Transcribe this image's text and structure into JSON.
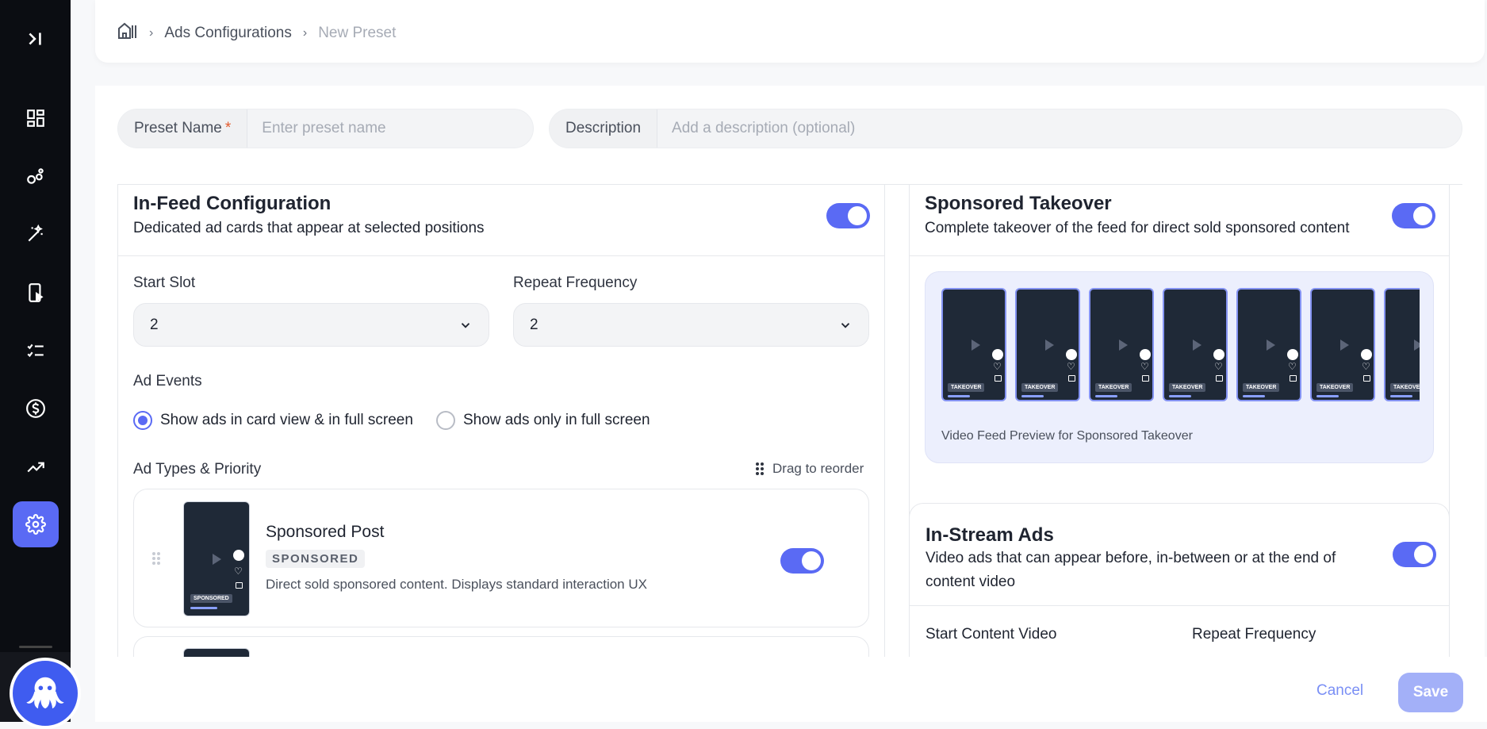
{
  "breadcrumb": {
    "items": [
      "Ads Configurations",
      "New Preset"
    ]
  },
  "form": {
    "preset_name_label": "Preset Name",
    "preset_name_required": "*",
    "preset_name_placeholder": "Enter preset name",
    "description_label": "Description",
    "description_placeholder": "Add a description (optional)"
  },
  "in_feed": {
    "title": "In-Feed Configuration",
    "subtitle": "Dedicated ad cards that appear at selected positions",
    "enabled": true,
    "start_slot_label": "Start Slot",
    "start_slot_value": "2",
    "repeat_frequency_label": "Repeat Frequency",
    "repeat_frequency_value": "2",
    "ad_events_label": "Ad Events",
    "ad_events_options": [
      "Show ads in card view & in full screen",
      "Show ads only in full screen"
    ],
    "ad_events_selected": 0,
    "ad_types_label": "Ad Types & Priority",
    "drag_hint": "Drag to reorder",
    "ad_types": [
      {
        "name": "Sponsored Post",
        "badge": "SPONSORED",
        "description": "Direct sold sponsored content. Displays standard interaction UX",
        "thumb_tag": "SPONSORED",
        "enabled": true
      }
    ]
  },
  "sponsored_takeover": {
    "title": "Sponsored Takeover",
    "subtitle": "Complete takeover of the feed for direct sold sponsored content",
    "enabled": true,
    "thumb_tag": "TAKEOVER",
    "preview_caption": "Video Feed Preview for Sponsored Takeover"
  },
  "in_stream": {
    "title": "In-Stream Ads",
    "subtitle_line1": "Video ads that can appear before, in-between or at the end of",
    "subtitle_line2": "content video",
    "enabled": true,
    "start_label": "Start Content Video",
    "repeat_label": "Repeat Frequency"
  },
  "actions": {
    "cancel": "Cancel",
    "save": "Save"
  },
  "colors": {
    "accent": "#5a6af4",
    "sidebar": "#0b0d12"
  }
}
